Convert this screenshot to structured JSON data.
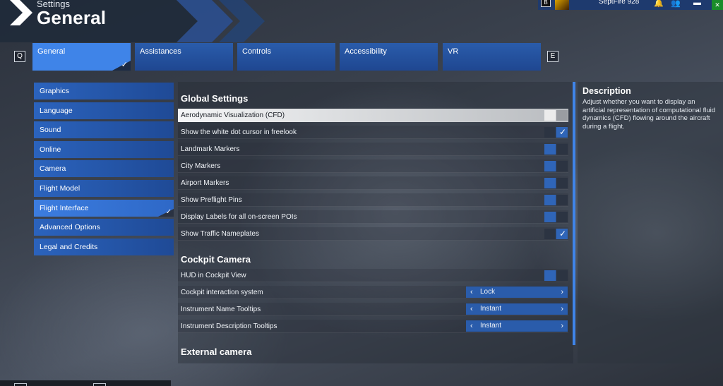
{
  "header": {
    "small": "Settings",
    "title": "General"
  },
  "userbar": {
    "key": "B",
    "username": "SeptFire 928"
  },
  "tabs": {
    "prev_key": "Q",
    "next_key": "E",
    "items": [
      {
        "label": "General"
      },
      {
        "label": "Assistances"
      },
      {
        "label": "Controls"
      },
      {
        "label": "Accessibility"
      },
      {
        "label": "VR"
      }
    ]
  },
  "nav": {
    "items": [
      {
        "label": "Graphics"
      },
      {
        "label": "Language"
      },
      {
        "label": "Sound"
      },
      {
        "label": "Online"
      },
      {
        "label": "Camera"
      },
      {
        "label": "Flight Model"
      },
      {
        "label": "Flight Interface"
      },
      {
        "label": "Advanced Options"
      },
      {
        "label": "Legal and Credits"
      }
    ]
  },
  "global": {
    "title": "Global Settings",
    "rows": [
      {
        "label": "Aerodynamic Visualization (CFD)",
        "state": "off"
      },
      {
        "label": "Show the white dot cursor in freelook",
        "state": "on"
      },
      {
        "label": "Landmark Markers",
        "state": "off"
      },
      {
        "label": "City Markers",
        "state": "off"
      },
      {
        "label": "Airport Markers",
        "state": "off"
      },
      {
        "label": "Show Preflight Pins",
        "state": "off"
      },
      {
        "label": "Display Labels for all on-screen POIs",
        "state": "off"
      },
      {
        "label": "Show Traffic Nameplates",
        "state": "on"
      }
    ]
  },
  "cockpit": {
    "title": "Cockpit Camera",
    "rows": [
      {
        "label": "HUD in Cockpit View",
        "state": "off"
      },
      {
        "label": "Cockpit interaction system",
        "value": "Lock"
      },
      {
        "label": "Instrument Name Tooltips",
        "value": "Instant"
      },
      {
        "label": "Instrument Description Tooltips",
        "value": "Instant"
      }
    ]
  },
  "external": {
    "title": "External camera"
  },
  "description": {
    "title": "Description",
    "text": "Adjust whether you want to display an artificial representation of computational fluid dynamics (CFD) flowing around the aircraft during a flight."
  },
  "colors": {
    "accent": "#3f84e8",
    "tab": "#2a5cab"
  }
}
